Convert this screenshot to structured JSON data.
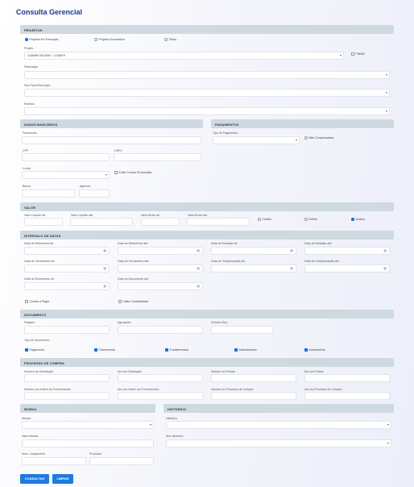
{
  "title": "Consulta Gerencial",
  "projetos": {
    "header": "PROJETOS",
    "radios": [
      "Projetos em Execução",
      "Projetos Encerrados",
      "Todos"
    ],
    "projeto_label": "Projeto",
    "projeto_value": "CADMIN GALDINO - 3-026879",
    "finam": "FINAM",
    "fase_label": "Fase/Ação",
    "subfase_label": "Sub-Fase/Sub-Ação",
    "rubrica_label": "Rubrica"
  },
  "dados": {
    "header": "DADOS BANCÁRIOS",
    "favorecido": "Favorecido",
    "cpf": "CPF",
    "cnpj": "CNPJ",
    "conta": "Conta",
    "exibir": "Exibir Contas Encerradas",
    "banco": "Banco",
    "agencia": "Agência"
  },
  "pagamentos": {
    "header": "PAGAMENTOS",
    "tipo": "Tipo de Pagamento",
    "nao_comp": "Não Compensados"
  },
  "valor": {
    "header": "VALOR",
    "labels": [
      "Valor Líquido de:",
      "Valor Líquido até:",
      "Valor Bruto de:",
      "Valor Bruto até:"
    ],
    "radios": [
      "Crédito",
      "Débito",
      "Ambos"
    ]
  },
  "datas": {
    "header": "INTERVALO DE DATAS",
    "labels": [
      "Data de Referência de:",
      "Data de Referência até:",
      "Data de Emissão de:",
      "Data de Emissão até:",
      "Data de Vencimento de:",
      "Data de Vencimento até:",
      "Data de Compensação de:",
      "Data de Compensação até:",
      "Data do Documento de:",
      "Data do Documento até:"
    ],
    "contas_pagar": "Contas a Pagar",
    "visao": "Visão Contabilidade"
  },
  "documento": {
    "header": "DOCUMENTO",
    "registro": "Registro",
    "agrupador": "Agrupador",
    "numero": "Número Doc.",
    "tipo": "Tipo de Documento :",
    "tipos": [
      "Pagamento",
      "Faturamento",
      "Transferências",
      "Adiantamento",
      "Investimento"
    ]
  },
  "compra": {
    "header": "PROCESSO DE COMPRA",
    "labels": [
      "Número da Solicitação",
      "Ano da Solicitação",
      "Número do Pedido",
      "Ano do Pedido",
      "Número da Ordem de Fornecimento",
      "Ano da Ordem de Fornecimento",
      "Número do Processo de Compra",
      "Ano do Processo de Compra"
    ]
  },
  "moeda": {
    "header": "MOEDA",
    "moeda": "Moeda",
    "valor": "Valor Moeda",
    "num": "Núm. Lançamento",
    "protocolo": "Protocolo"
  },
  "historico": {
    "header": "HISTÓRICO",
    "historico": "Histórico",
    "sub": "Sub-Histórico"
  },
  "buttons": {
    "consultar": "CONSULTAR",
    "limpar": "LIMPAR"
  },
  "colors": {
    "accent": "#1e7be0",
    "header_bar": "#cfd9e0",
    "title": "#1c3a8c"
  }
}
